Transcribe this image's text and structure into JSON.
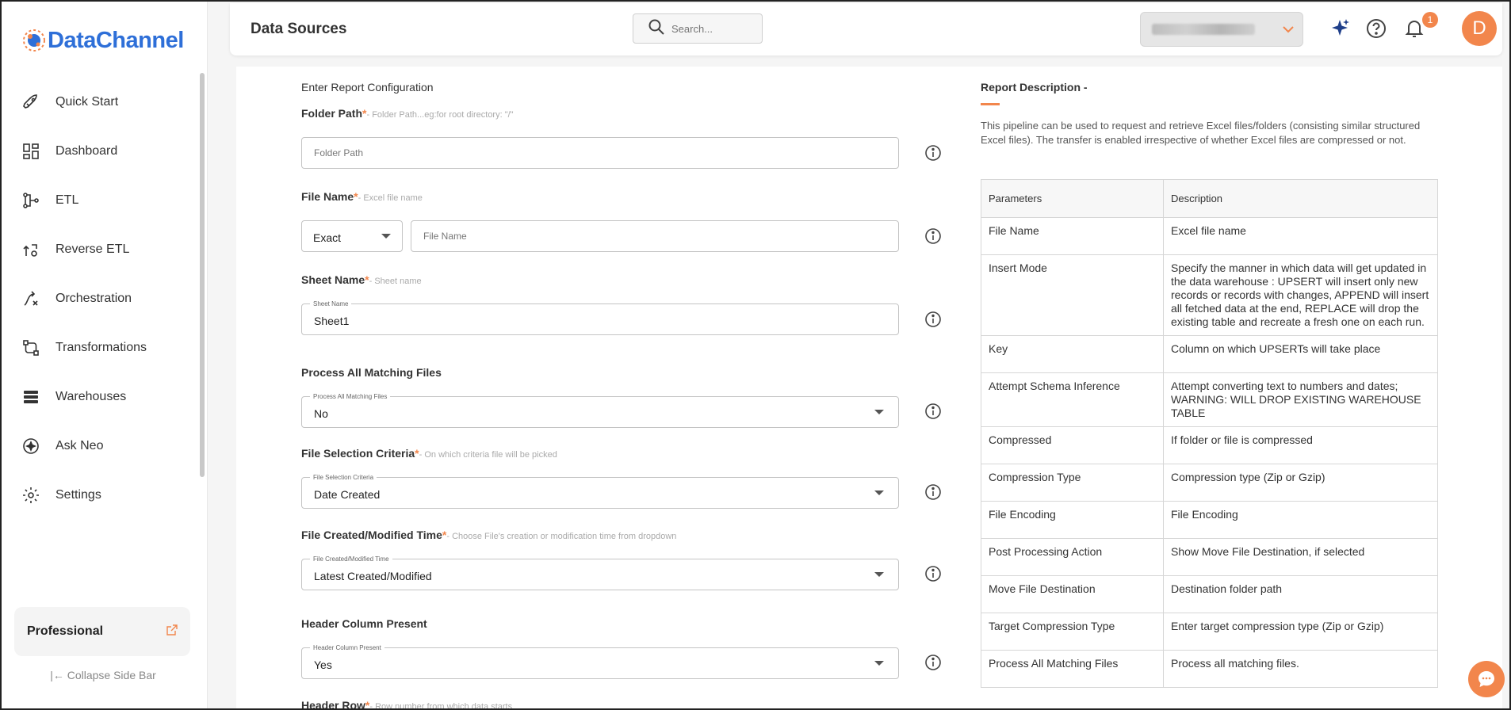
{
  "brand": {
    "name": "DataChannel"
  },
  "sidebar": {
    "items": [
      {
        "label": "Quick Start",
        "icon": "rocket-icon"
      },
      {
        "label": "Dashboard",
        "icon": "dashboard-icon"
      },
      {
        "label": "ETL",
        "icon": "etl-icon"
      },
      {
        "label": "Reverse ETL",
        "icon": "reverse-etl-icon"
      },
      {
        "label": "Orchestration",
        "icon": "orchestration-icon"
      },
      {
        "label": "Transformations",
        "icon": "transformations-icon"
      },
      {
        "label": "Warehouses",
        "icon": "warehouses-icon"
      },
      {
        "label": "Ask Neo",
        "icon": "sparkle-icon"
      },
      {
        "label": "Settings",
        "icon": "gear-icon"
      }
    ],
    "plan": "Professional",
    "collapse_label": "|← Collapse Side Bar"
  },
  "header": {
    "title": "Data Sources",
    "search_placeholder": "Search...",
    "notification_count": "1",
    "avatar_initial": "D"
  },
  "form": {
    "section_title": "Enter Report Configuration",
    "folder_path": {
      "label": "Folder Path",
      "hint": "- Folder Path...eg:for root directory: \"/\"",
      "placeholder": "Folder Path"
    },
    "file_name": {
      "label": "File Name",
      "hint": "- Excel file name",
      "match_value": "Exact",
      "placeholder": "File Name"
    },
    "sheet_name": {
      "label": "Sheet Name",
      "hint": "- Sheet name",
      "floating": "Sheet Name",
      "value": "Sheet1"
    },
    "process_all": {
      "label": "Process All Matching Files",
      "floating": "Process All Matching Files",
      "value": "No"
    },
    "selection_criteria": {
      "label": "File Selection Criteria",
      "hint": "- On which criteria file will be picked",
      "floating": "File Selection Criteria",
      "value": "Date Created"
    },
    "created_time": {
      "label": "File Created/Modified Time",
      "hint": "- Choose File's creation or modification time from dropdown",
      "floating": "File Created/Modified Time",
      "value": "Latest Created/Modified"
    },
    "header_present": {
      "label": "Header Column Present",
      "floating": "Header Column Present",
      "value": "Yes"
    },
    "header_row": {
      "label": "Header Row",
      "hint": "- Row number from which data starts"
    },
    "required_mark": "*"
  },
  "report": {
    "title": "Report Description -",
    "text": "This pipeline can be used to request and retrieve Excel files/folders (consisting similar structured Excel files). The transfer is enabled irrespective of whether Excel files are compressed or not.",
    "headers": [
      "Parameters",
      "Description"
    ],
    "rows": [
      [
        "File Name",
        "Excel file name"
      ],
      [
        "Insert Mode",
        "Specify the manner in which data will get updated in the data warehouse : UPSERT will insert only new records or records with changes, APPEND will insert all fetched data at the end, REPLACE will drop the existing table and recreate a fresh one on each run."
      ],
      [
        "Key",
        "Column on which UPSERTs will take place"
      ],
      [
        "Attempt Schema Inference",
        "Attempt converting text to numbers and dates; WARNING: WILL DROP EXISTING WAREHOUSE TABLE"
      ],
      [
        "Compressed",
        "If folder or file is compressed"
      ],
      [
        "Compression Type",
        "Compression type (Zip or Gzip)"
      ],
      [
        "File Encoding",
        "File Encoding"
      ],
      [
        "Post Processing Action",
        "Show Move File Destination, if selected"
      ],
      [
        "Move File Destination",
        "Destination folder path"
      ],
      [
        "Target Compression Type",
        "Enter target compression type (Zip or Gzip)"
      ],
      [
        "Process All Matching Files",
        "Process all matching files."
      ]
    ]
  },
  "colors": {
    "accent": "#f2864c",
    "brand": "#2e6fd8"
  }
}
